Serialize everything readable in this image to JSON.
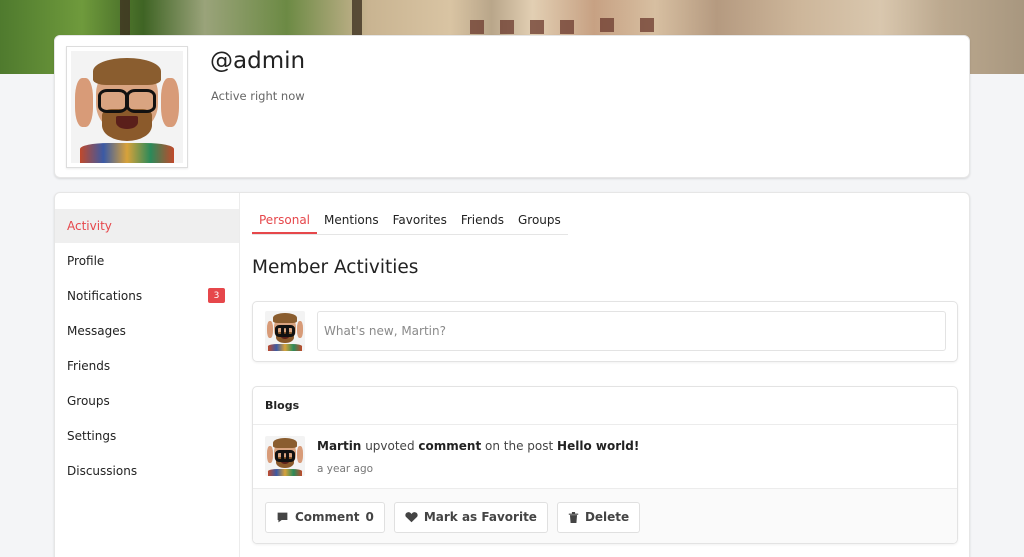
{
  "profile": {
    "username": "@admin",
    "status": "Active right now"
  },
  "sidebar": {
    "items": [
      {
        "label": "Activity",
        "active": true
      },
      {
        "label": "Profile"
      },
      {
        "label": "Notifications",
        "badge": "3"
      },
      {
        "label": "Messages"
      },
      {
        "label": "Friends"
      },
      {
        "label": "Groups"
      },
      {
        "label": "Settings"
      },
      {
        "label": "Discussions"
      }
    ]
  },
  "tabs": [
    {
      "label": "Personal",
      "active": true
    },
    {
      "label": "Mentions"
    },
    {
      "label": "Favorites"
    },
    {
      "label": "Friends"
    },
    {
      "label": "Groups"
    }
  ],
  "main": {
    "title": "Member Activities",
    "post_placeholder": "What's new, Martin?"
  },
  "activity": {
    "group_title": "Blogs",
    "actor": "Martin",
    "verb": "upvoted",
    "object": "comment",
    "connector": "on the post",
    "post_title": "Hello world!",
    "time": "a year ago",
    "actions": {
      "comment_label": "Comment",
      "comment_count": "0",
      "favorite_label": "Mark as Favorite",
      "delete_label": "Delete"
    }
  },
  "colors": {
    "accent": "#e6474b",
    "badge_bg": "#e6474b"
  },
  "icons": [
    "comment-icon",
    "heart-icon",
    "trash-icon"
  ]
}
